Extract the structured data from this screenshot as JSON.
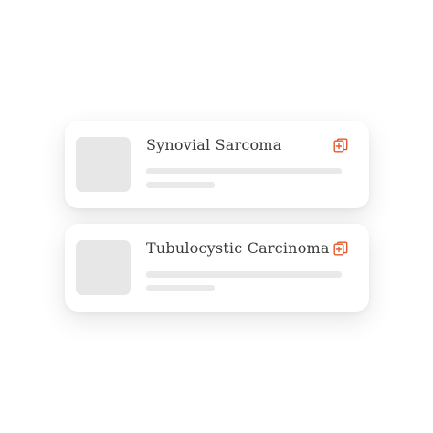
{
  "accent_color": "#e4572e",
  "cards": [
    {
      "title": "Synovial Sarcoma",
      "action_icon": "add-to-collection-icon"
    },
    {
      "title": "Tubulocystic Carcinoma",
      "action_icon": "add-to-collection-icon"
    }
  ]
}
